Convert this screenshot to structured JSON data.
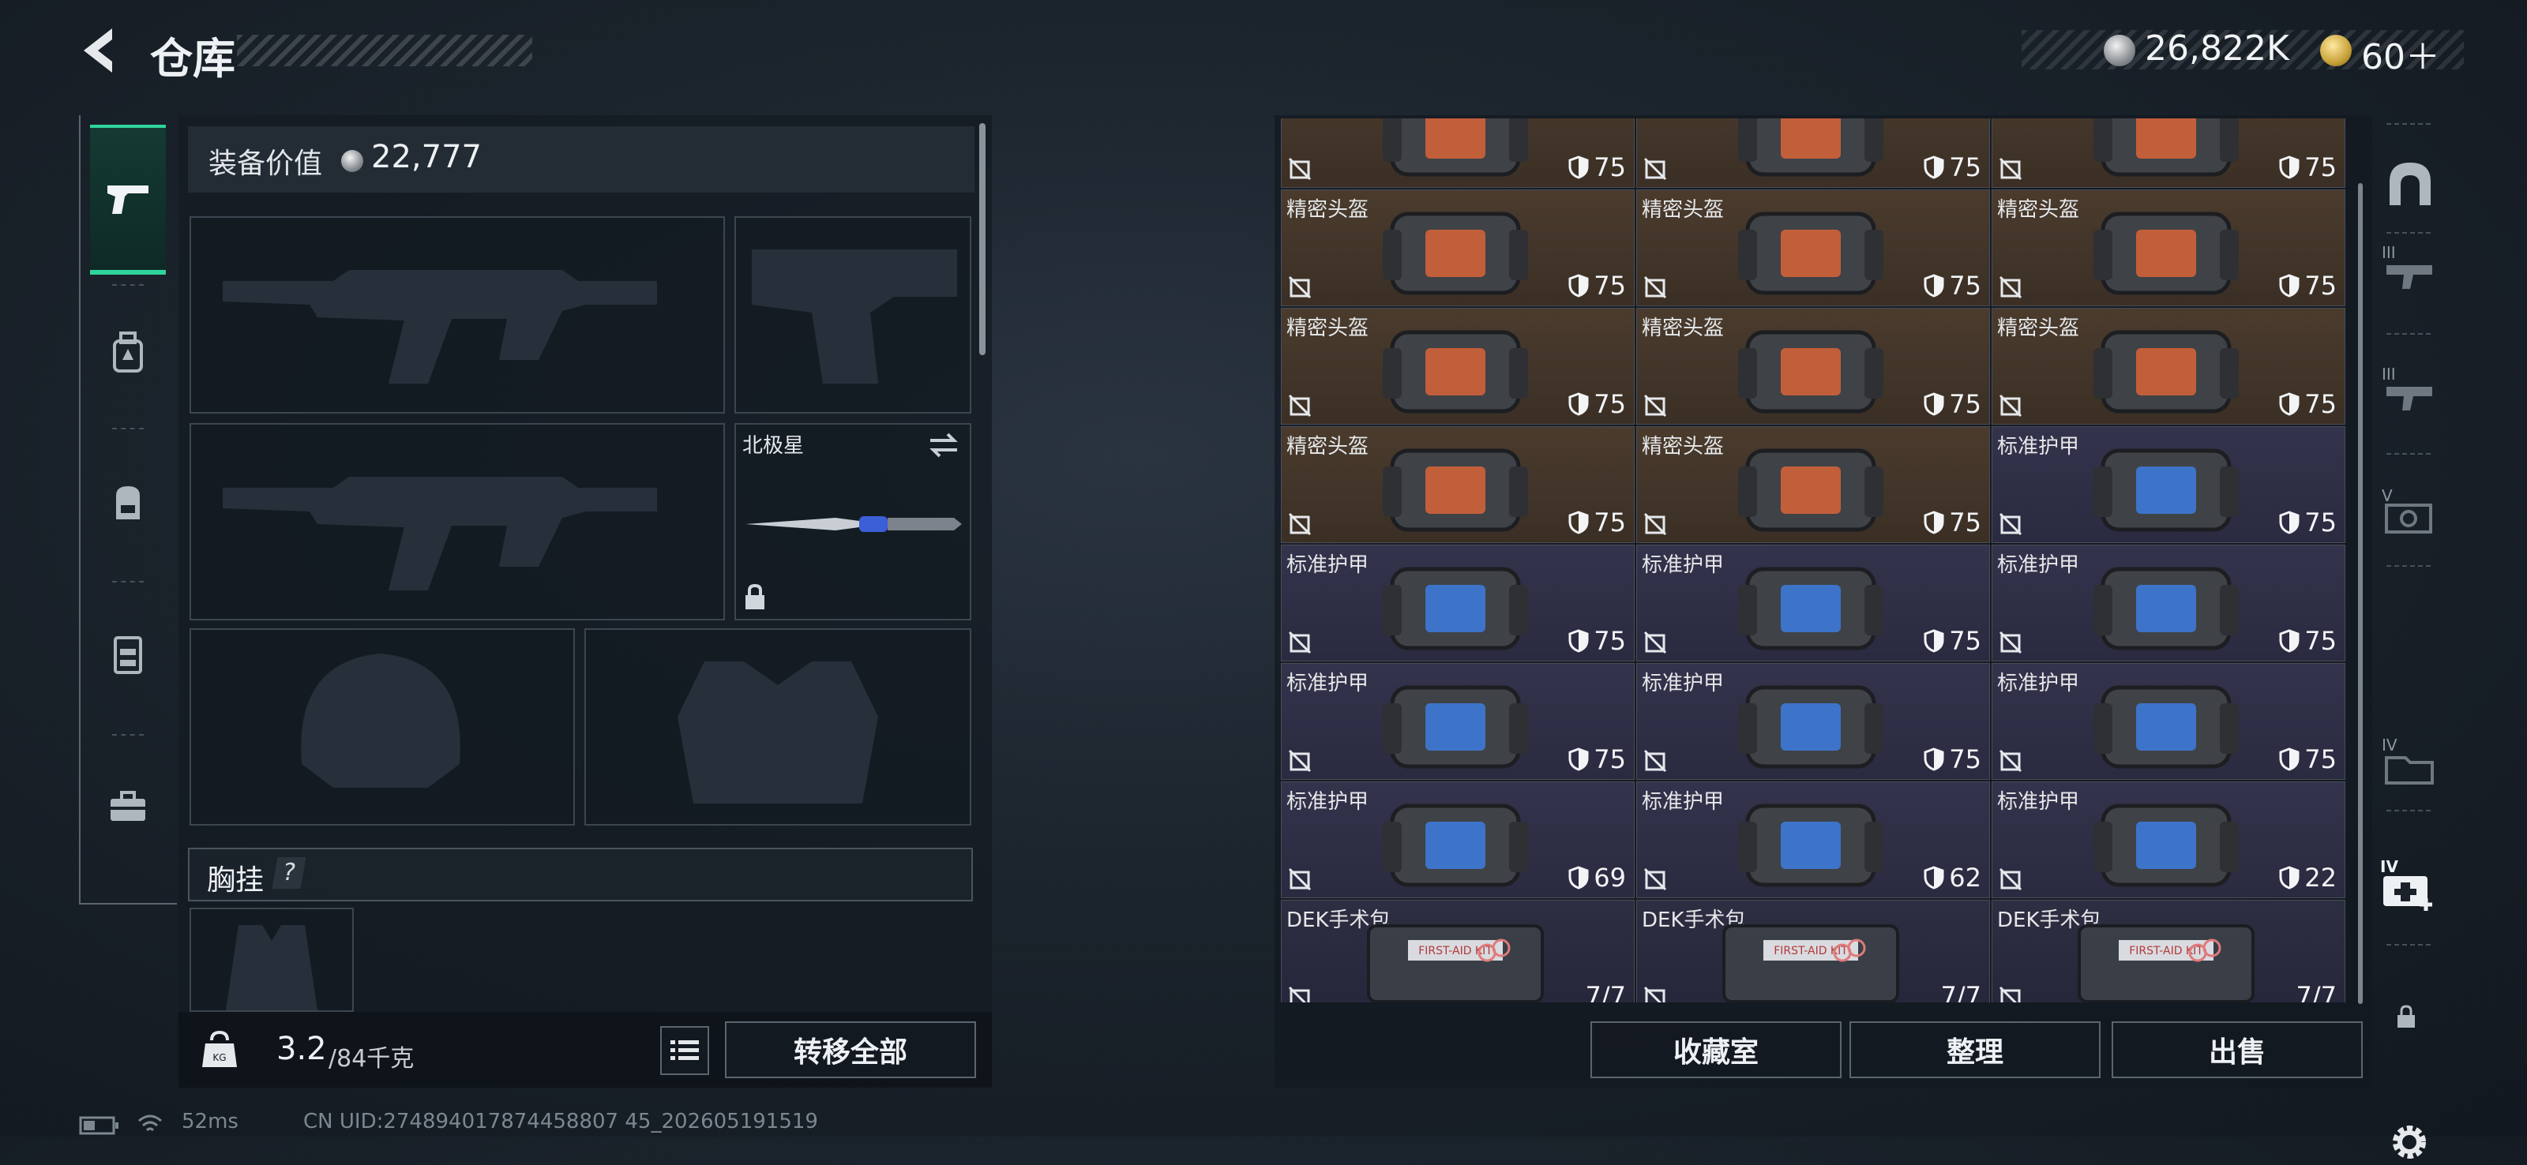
{
  "header": {
    "title": "仓库",
    "currency_silver": "26,822K",
    "currency_gold": "60＋"
  },
  "left_tabs": [
    {
      "icon": "pistol-icon",
      "active": true
    },
    {
      "icon": "ammo-pack-icon",
      "active": false
    },
    {
      "icon": "backpack-icon",
      "active": false
    },
    {
      "icon": "chest-rig-icon",
      "active": false
    },
    {
      "icon": "toolbox-icon",
      "active": false
    }
  ],
  "equipment": {
    "value_label": "装备价值",
    "value": "22,777",
    "slots": [
      {
        "name": "primary-weapon-slot",
        "content": "rifle-silhouette"
      },
      {
        "name": "sidearm-slot",
        "content": "pistol-silhouette"
      },
      {
        "name": "secondary-weapon-slot",
        "content": "rifle-silhouette"
      },
      {
        "name": "melee-slot",
        "label": "北极星",
        "locked": true
      },
      {
        "name": "helmet-slot",
        "content": "helmet-silhouette"
      },
      {
        "name": "armor-slot",
        "content": "armor-silhouette"
      }
    ],
    "chest_rig_label": "胸挂",
    "chest_rig_help": "?"
  },
  "weight": {
    "current": "3.2",
    "max": "/84千克",
    "transfer_all": "转移全部"
  },
  "grid": {
    "rows": [
      [
        {
          "type": "helmet",
          "name": "",
          "dur": "75"
        },
        {
          "type": "helmet",
          "name": "",
          "dur": "75"
        },
        {
          "type": "helmet",
          "name": "",
          "dur": "75"
        }
      ],
      [
        {
          "type": "helmet",
          "name": "精密头盔",
          "dur": "75"
        },
        {
          "type": "helmet",
          "name": "精密头盔",
          "dur": "75"
        },
        {
          "type": "helmet",
          "name": "精密头盔",
          "dur": "75"
        }
      ],
      [
        {
          "type": "helmet",
          "name": "精密头盔",
          "dur": "75"
        },
        {
          "type": "helmet",
          "name": "精密头盔",
          "dur": "75"
        },
        {
          "type": "helmet",
          "name": "精密头盔",
          "dur": "75"
        }
      ],
      [
        {
          "type": "helmet",
          "name": "精密头盔",
          "dur": "75"
        },
        {
          "type": "helmet",
          "name": "精密头盔",
          "dur": "75"
        },
        {
          "type": "armor",
          "name": "标准护甲",
          "dur": "75"
        }
      ],
      [
        {
          "type": "armor",
          "name": "标准护甲",
          "dur": "75"
        },
        {
          "type": "armor",
          "name": "标准护甲",
          "dur": "75"
        },
        {
          "type": "armor",
          "name": "标准护甲",
          "dur": "75"
        }
      ],
      [
        {
          "type": "armor",
          "name": "标准护甲",
          "dur": "75"
        },
        {
          "type": "armor",
          "name": "标准护甲",
          "dur": "75"
        },
        {
          "type": "armor",
          "name": "标准护甲",
          "dur": "75"
        }
      ],
      [
        {
          "type": "armor",
          "name": "标准护甲",
          "dur": "69"
        },
        {
          "type": "armor",
          "name": "标准护甲",
          "dur": "62"
        },
        {
          "type": "armor",
          "name": "标准护甲",
          "dur": "22"
        }
      ],
      [
        {
          "type": "med",
          "name": "DEK手术包",
          "uses": "7/7"
        },
        {
          "type": "med",
          "name": "DEK手术包",
          "uses": "7/7"
        },
        {
          "type": "med",
          "name": "DEK手术包",
          "uses": "7/7"
        }
      ]
    ]
  },
  "actions": {
    "collection": "收藏室",
    "sort": "整理",
    "sell": "出售"
  },
  "right_sidebar": [
    {
      "icon": "storage-arch-icon",
      "label": ""
    },
    {
      "icon": "stash-tier-icon",
      "label": "III"
    },
    {
      "icon": "stash-tier-icon",
      "label": "III"
    },
    {
      "icon": "stash-tier-icon",
      "label": "V"
    },
    {
      "icon": "stash-tier-icon",
      "label": "IV"
    },
    {
      "icon": "medical-tier-icon",
      "label": "IV"
    },
    {
      "icon": "lock-icon",
      "label": ""
    },
    {
      "icon": "gear-icon",
      "label": ""
    }
  ],
  "status": {
    "ping": "52ms",
    "uid": "CN UID:274894017874458807 45_202605191519"
  }
}
